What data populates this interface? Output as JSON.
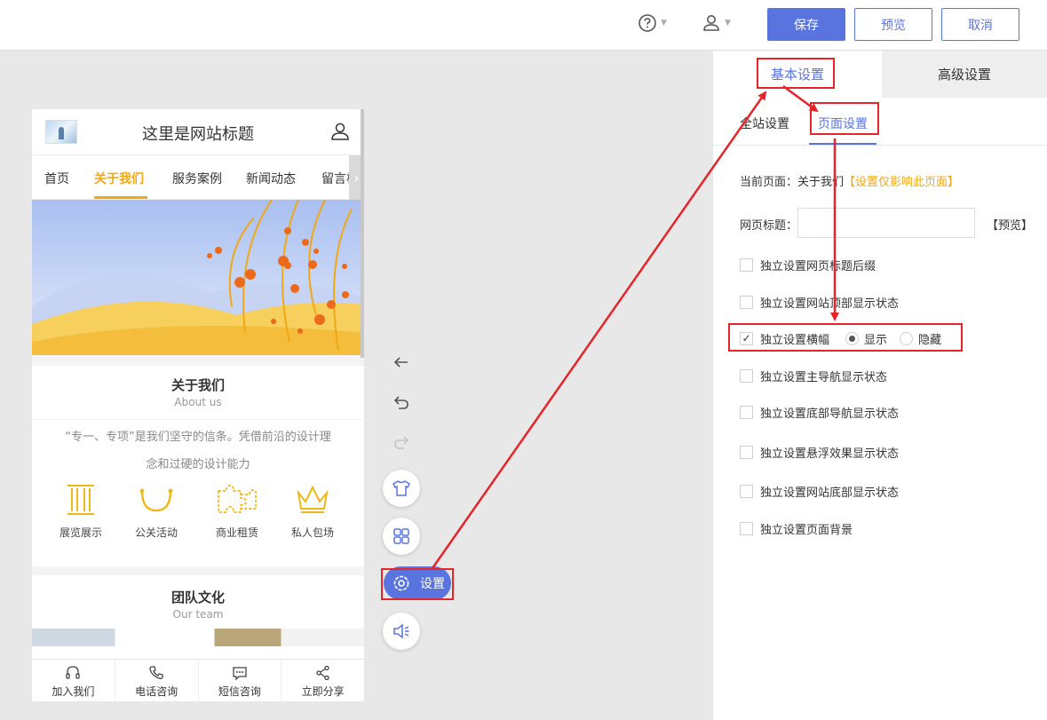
{
  "topbar": {
    "help_icon": "question-circle-icon",
    "user_icon": "user-icon",
    "save_label": "保存",
    "preview_label": "预览",
    "cancel_label": "取消",
    "accent_color": "#5a74df"
  },
  "phone": {
    "site_title": "这里是网站标题",
    "nav": [
      "首页",
      "关于我们",
      "服务案例",
      "新闻动态",
      "留言板"
    ],
    "active_nav": "关于我们",
    "about": {
      "title": "关于我们",
      "subtitle": "About us",
      "desc_line1": "“专一、专项”是我们坚守的信条。凭借前沿的设计理",
      "desc_line2": "念和过硬的设计能力"
    },
    "features": [
      {
        "label": "展览展示",
        "icon": "pillars-icon"
      },
      {
        "label": "公关活动",
        "icon": "smile-arc-icon"
      },
      {
        "label": "商业租赁",
        "icon": "puzzle-icon"
      },
      {
        "label": "私人包场",
        "icon": "crown-icon"
      }
    ],
    "team": {
      "title": "团队文化",
      "subtitle": "Our team"
    },
    "bottom_bar": [
      {
        "label": "加入我们",
        "icon": "headset-icon"
      },
      {
        "label": "电话咨询",
        "icon": "phone-icon"
      },
      {
        "label": "短信咨询",
        "icon": "message-icon"
      },
      {
        "label": "立即分享",
        "icon": "share-icon"
      }
    ],
    "highlight_color": "#f0a816"
  },
  "side_tools": {
    "settings_label": "设置"
  },
  "panel": {
    "tab_basic": "基本设置",
    "tab_advanced": "高级设置",
    "subtab_site": "全站设置",
    "subtab_page": "页面设置",
    "current_page_label": "当前页面：关于我们",
    "current_page_link": "【设置仅影响此页面】",
    "title_label": "网页标题：",
    "title_value": "",
    "title_preview": "【预览】",
    "options": [
      {
        "label": "独立设置网页标题后缀",
        "checked": false
      },
      {
        "label": "独立设置网站顶部显示状态",
        "checked": false
      },
      {
        "label": "独立设置横幅",
        "checked": true
      },
      {
        "label": "独立设置主导航显示状态",
        "checked": false
      },
      {
        "label": "独立设置底部导航显示状态",
        "checked": false
      },
      {
        "label": "独立设置悬浮效果显示状态",
        "checked": false
      },
      {
        "label": "独立设置网站底部显示状态",
        "checked": false
      },
      {
        "label": "独立设置页面背景",
        "checked": false
      }
    ],
    "banner_show": "显示",
    "banner_hide": "隐藏",
    "banner_selected": "显示"
  },
  "annotation_color": "#e5252a"
}
